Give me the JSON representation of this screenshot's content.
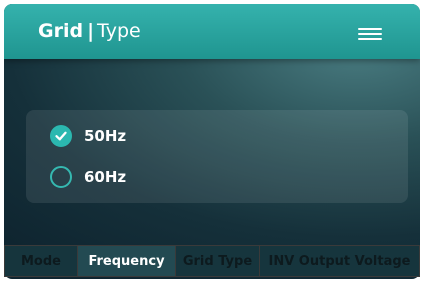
{
  "header": {
    "title_bold": "Grid",
    "separator": "|",
    "title_light": "Type",
    "menu_icon": "hamburger-menu-icon"
  },
  "options": [
    {
      "label": "50Hz",
      "checked": true
    },
    {
      "label": "60Hz",
      "checked": false
    }
  ],
  "tabs": [
    {
      "label": "Mode",
      "active": false
    },
    {
      "label": "Frequency",
      "active": true
    },
    {
      "label": "Grid Type",
      "active": false
    },
    {
      "label": "INV Output Voltage",
      "active": false
    }
  ],
  "colors": {
    "accent": "#2bb8b0",
    "header": "#2aa5a0",
    "background": "#15303a"
  }
}
